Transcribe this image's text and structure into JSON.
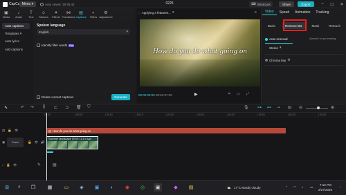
{
  "app": {
    "name": "CapCut",
    "menu_label": "Menu",
    "autosave_text": "Auto saved: 19:35:42",
    "project_title": "0225",
    "shortcuts_label": "Shortcuts",
    "share_label": "Share",
    "export_label": "Export",
    "accent": "#18b1c4"
  },
  "toolbar": {
    "items": [
      {
        "label": "Media",
        "icon": "media-icon"
      },
      {
        "label": "Audio",
        "icon": "audio-icon"
      },
      {
        "label": "Text",
        "icon": "text-icon"
      },
      {
        "label": "Stickers",
        "icon": "stickers-icon"
      },
      {
        "label": "Effects",
        "icon": "effects-icon"
      },
      {
        "label": "Transitions",
        "icon": "transitions-icon"
      },
      {
        "label": "Captions",
        "icon": "captions-icon",
        "active": true
      },
      {
        "label": "Filters",
        "icon": "filters-icon"
      },
      {
        "label": "Adjustment",
        "icon": "adjustment-icon"
      }
    ]
  },
  "leftnav": {
    "items": [
      "Auto captions",
      "Templates",
      "Auto lyrics",
      "Add captions"
    ]
  },
  "captions_panel": {
    "spoken_language_label": "Spoken language",
    "language_value": "English",
    "filler_label": "Identify filler words",
    "filler_badge": "Pro",
    "delete_label": "Delete current captions",
    "generate_label": "Generate"
  },
  "player": {
    "status": "Applying 3 features...",
    "caption_text": "How do you do what going on",
    "current_time": "00:00:00:00",
    "total_time": "00:01:07:20"
  },
  "right_panel": {
    "tabs": [
      "Video",
      "Speed",
      "Animation",
      "Tracking"
    ],
    "active_tab": "Video",
    "subtabs": [
      "Basic",
      "Remove BG",
      "Mask",
      "Retouch"
    ],
    "active_subtab": "Remove BG",
    "auto_removal_label": "Auto removal",
    "queued_text": "Queued for processing",
    "stroke_label": "Stroke",
    "chroma_key_label": "Chroma key"
  },
  "timeline": {
    "ruler_ticks": [
      "00:00",
      "| 00:05",
      "| 00:10",
      "| 00:15",
      "| 00:20",
      "| 00:25",
      "| 00:30",
      "| 00:35",
      "| 00:40",
      "| 00:45"
    ],
    "caption_clip_label": "How do you do what going on",
    "video_clip_label": "Summer landscape",
    "video_clip_duration": "00:00:14:14",
    "video_clip_size": "Apa",
    "cover_label": "Cover"
  },
  "taskbar": {
    "weather": "17°C  Mostly cloudy",
    "time": "7:15 PM",
    "date": "2/27/2025"
  }
}
